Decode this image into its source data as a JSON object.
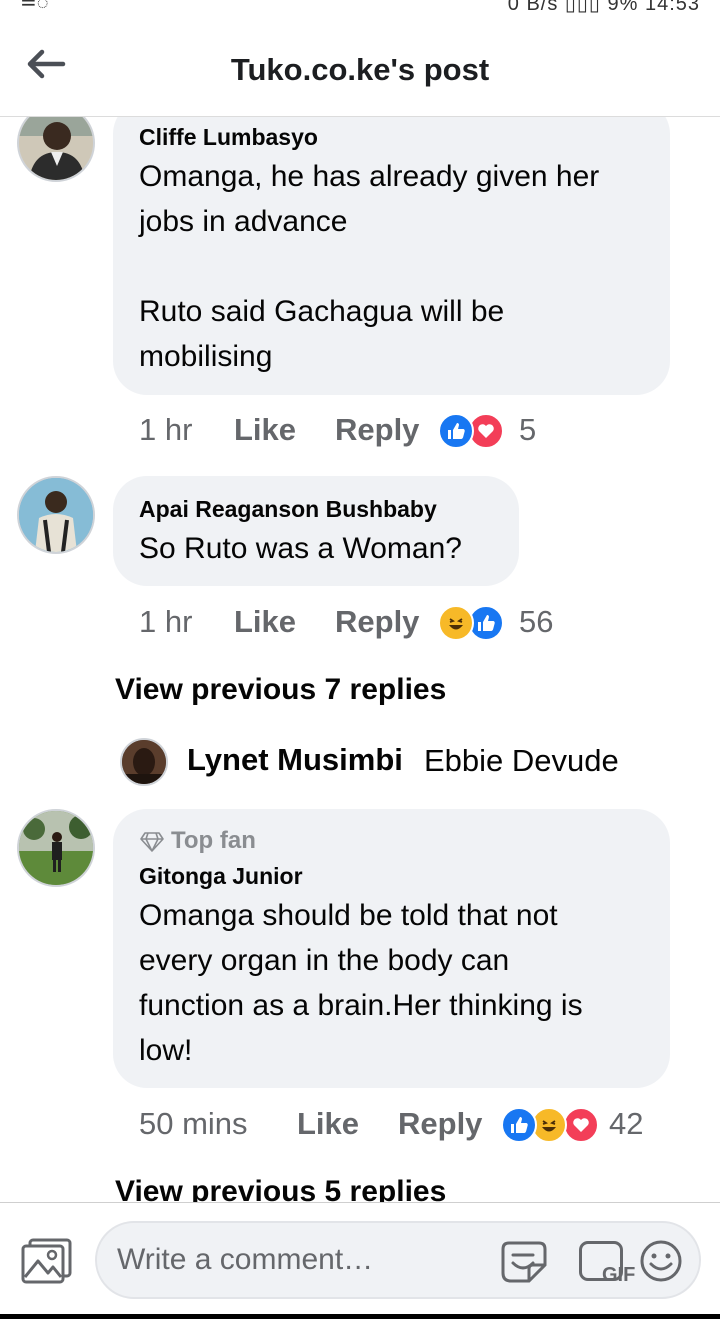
{
  "status_bar": {
    "left": "≗◌",
    "right": "0 B/s ▯▯▯ 9% 14:53"
  },
  "header": {
    "title": "Tuko.co.ke's post",
    "back_icon": "arrow-left-icon"
  },
  "comments": [
    {
      "author": "Cliffe Lumbasyo",
      "text": "Omanga, he has already given her\njobs in advance\n\nRuto said Gachagua will be\nmobilising",
      "time": "1 hr",
      "like_label": "Like",
      "reply_label": "Reply",
      "reactions": [
        "like",
        "love"
      ],
      "reaction_count": "5"
    },
    {
      "author": "Apai Reaganson Bushbaby",
      "text": "So Ruto was a Woman?",
      "time": "1 hr",
      "like_label": "Like",
      "reply_label": "Reply",
      "reactions": [
        "haha",
        "like"
      ],
      "reaction_count": "56"
    },
    {
      "badge": "Top fan",
      "author": "Gitonga Junior",
      "text": "Omanga should be told that not\nevery organ in the body can\nfunction as a brain.Her thinking is\nlow!",
      "time": "50 mins",
      "like_label": "Like",
      "reply_label": "Reply",
      "reactions": [
        "like",
        "haha",
        "love"
      ],
      "reaction_count": "42"
    }
  ],
  "view_previous_1": "View previous 7 replies",
  "reply_preview": {
    "author": "Lynet Musimbi",
    "text": "Ebbie Devude"
  },
  "view_previous_2": "View previous 5 replies",
  "composer": {
    "placeholder": "Write a comment…",
    "gif_label": "GIF"
  },
  "colors": {
    "like_blue": "#1877f2",
    "love_red": "#f33e58",
    "haha_yellow": "#f7b928",
    "bubble": "#f0f2f5",
    "meta": "#65676b"
  }
}
